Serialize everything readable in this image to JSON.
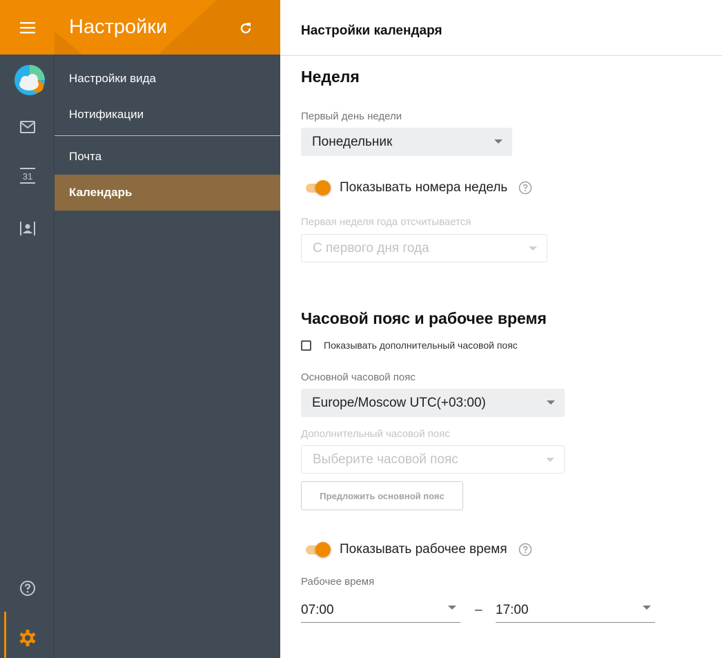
{
  "app": {
    "title": "Настройки"
  },
  "nav": {
    "items": [
      {
        "label": "Настройки вида",
        "active": false
      },
      {
        "label": "Нотификации",
        "active": false
      },
      {
        "label": "Почта",
        "active": false
      },
      {
        "label": "Календарь",
        "active": true
      }
    ]
  },
  "rail": {
    "icons": [
      "menu-icon",
      "weather-app-icon",
      "mail-icon",
      "calendar-icon",
      "contacts-icon",
      "help-icon",
      "settings-icon"
    ],
    "calendar_day": "31"
  },
  "page": {
    "title": "Настройки календаря",
    "week": {
      "heading": "Неделя",
      "first_day_label": "Первый день недели",
      "first_day_value": "Понедельник",
      "show_week_numbers_label": "Показывать номера недель",
      "show_week_numbers": true,
      "first_week_label": "Первая неделя года отсчитывается",
      "first_week_value": "С первого дня года"
    },
    "timezone": {
      "heading": "Часовой пояс и рабочее время",
      "show_additional_label": "Показывать дополнительный часовой пояс",
      "show_additional": false,
      "main_tz_label": "Основной часовой пояс",
      "main_tz_value": "Europe/Moscow UTC(+03:00)",
      "additional_tz_label": "Дополнительный часовой пояс",
      "additional_tz_placeholder": "Выберите часовой пояс",
      "suggest_button": "Предложить основной пояс",
      "show_work_hours_label": "Показывать рабочее время",
      "show_work_hours": true,
      "work_hours_label": "Рабочее время",
      "work_start": "07:00",
      "work_separator": "–",
      "work_end": "17:00"
    }
  },
  "colors": {
    "accent": "#f08a00",
    "sidebar": "#414b56",
    "active_item": "#8b6b3f"
  }
}
